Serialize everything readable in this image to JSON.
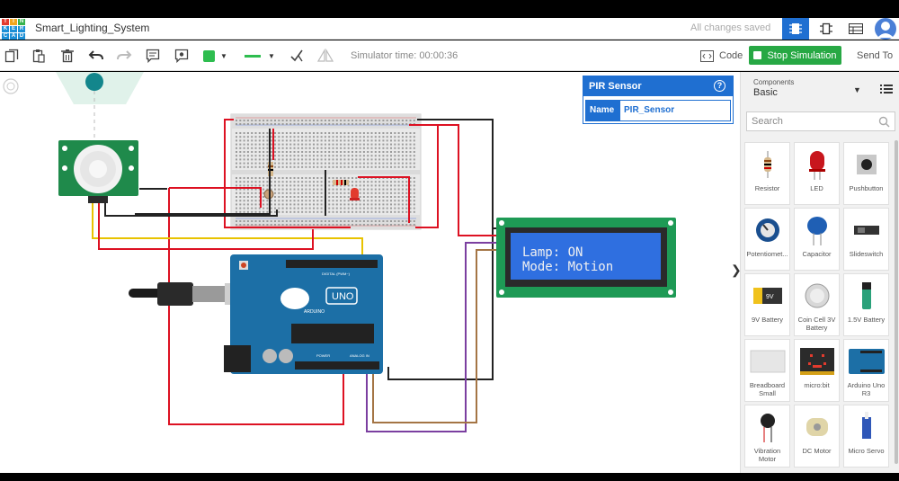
{
  "app": {
    "project_title": "Smart_Lighting_System",
    "save_status": "All changes saved",
    "logo_letters": [
      "T",
      "I",
      "N",
      "K",
      "E",
      "R",
      "C",
      "A",
      "D"
    ]
  },
  "toolbar": {
    "sim_time": "Simulator time: 00:00:36",
    "code_label": "Code",
    "stop_label": "Stop Simulation",
    "send_label": "Send To",
    "accent": "#27a844"
  },
  "props": {
    "title": "PIR Sensor",
    "help": "?",
    "name_label": "Name",
    "name_value": "PIR_Sensor"
  },
  "lcd": {
    "line1": "Lamp: ON",
    "line2": "Mode: Motion"
  },
  "board": {
    "label": "UNO",
    "brand": "ARDUINO",
    "digital": "DIGITAL (PWM~)",
    "power": "POWER",
    "analog": "ANALOG IN"
  },
  "panel": {
    "components_label": "Components",
    "components_value": "Basic",
    "search_placeholder": "Search",
    "items": [
      {
        "label": "Resistor",
        "icon": "resistor-icon"
      },
      {
        "label": "LED",
        "icon": "led-icon"
      },
      {
        "label": "Pushbutton",
        "icon": "pushbutton-icon"
      },
      {
        "label": "Potentiomet...",
        "icon": "potentiometer-icon"
      },
      {
        "label": "Capacitor",
        "icon": "capacitor-icon"
      },
      {
        "label": "Slideswitch",
        "icon": "slideswitch-icon"
      },
      {
        "label": "9V Battery",
        "icon": "battery-9v-icon"
      },
      {
        "label": "Coin Cell 3V Battery",
        "icon": "coin-cell-icon"
      },
      {
        "label": "1.5V Battery",
        "icon": "battery-15v-icon"
      },
      {
        "label": "Breadboard Small",
        "icon": "breadboard-icon"
      },
      {
        "label": "micro:bit",
        "icon": "microbit-icon"
      },
      {
        "label": "Arduino Uno R3",
        "icon": "arduino-icon"
      },
      {
        "label": "Vibration Motor",
        "icon": "vibration-motor-icon"
      },
      {
        "label": "DC Motor",
        "icon": "dc-motor-icon"
      },
      {
        "label": "Micro Servo",
        "icon": "micro-servo-icon"
      }
    ]
  }
}
